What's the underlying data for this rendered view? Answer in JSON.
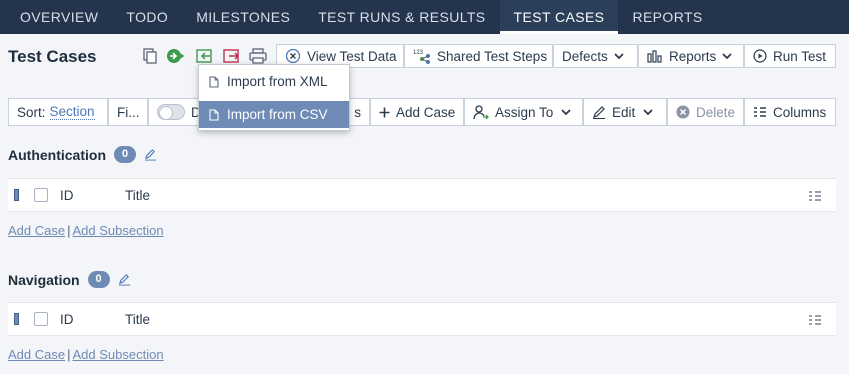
{
  "nav": {
    "tabs": [
      "OVERVIEW",
      "TODO",
      "MILESTONES",
      "TEST RUNS & RESULTS",
      "TEST CASES",
      "REPORTS"
    ],
    "active": "TEST CASES"
  },
  "header": {
    "title": "Test Cases",
    "buttons": {
      "view_test_data": "View Test Data",
      "shared_steps": "Shared Test Steps",
      "shared_steps_sup": "123",
      "defects": "Defects",
      "reports": "Reports",
      "run_test": "Run Test"
    }
  },
  "toolbar": {
    "sort_label": "Sort:",
    "sort_value": "Section",
    "filter_label": "Fi...",
    "display_partial": "D",
    "display_suffix": "s",
    "add_case": "Add Case",
    "assign_to": "Assign To",
    "edit": "Edit",
    "delete": "Delete",
    "columns": "Columns"
  },
  "dropdown": {
    "items": [
      "Import from XML",
      "Import from CSV"
    ],
    "highlighted": "Import from CSV"
  },
  "sections": [
    {
      "name": "Authentication",
      "count": "0",
      "col_id": "ID",
      "col_title": "Title",
      "add_case": "Add Case",
      "sep": "|",
      "add_subsection": "Add Subsection"
    },
    {
      "name": "Navigation",
      "count": "0",
      "col_id": "ID",
      "col_title": "Title",
      "add_case": "Add Case",
      "sep": "|",
      "add_subsection": "Add Subsection"
    }
  ],
  "colors": {
    "nav_bg": "#23344c",
    "accent": "#6d8bb5",
    "import_icon_green": "#3f9a4c",
    "export_icon_red": "#c0314f",
    "background": "#f3f5f8"
  }
}
